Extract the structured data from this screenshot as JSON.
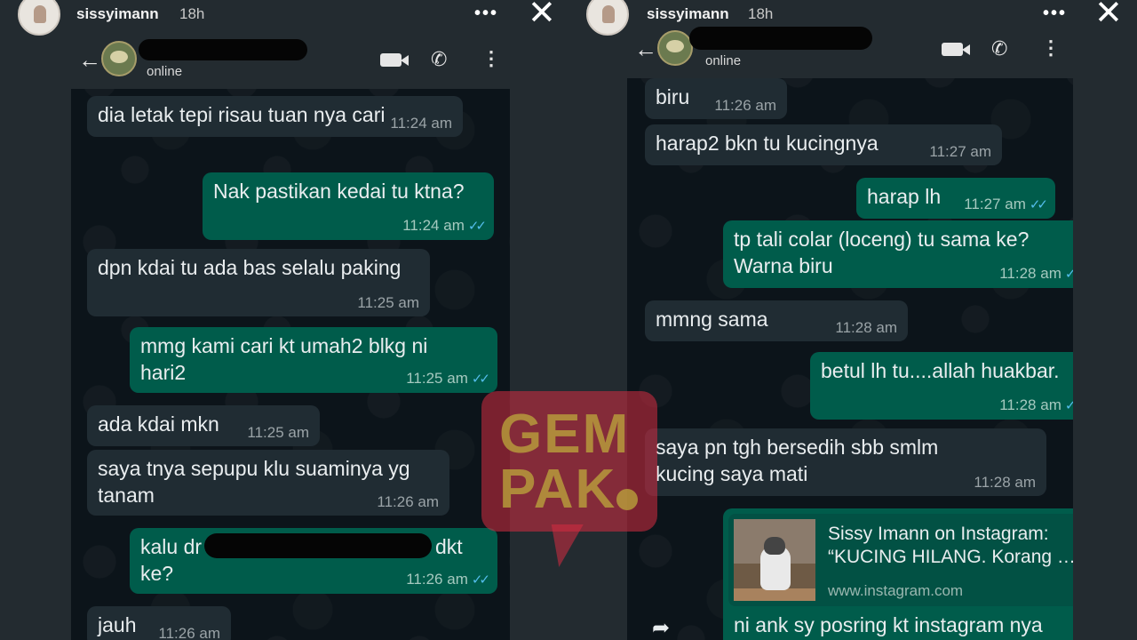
{
  "story": {
    "username": "sissyimann",
    "time_ago": "18h",
    "more_label": "•••",
    "close_label": "✕"
  },
  "chat": {
    "status": "online",
    "back_label": "←",
    "phone_label": "✆",
    "menu_label": "⋮"
  },
  "left_messages": [
    {
      "dir": "in",
      "text": "dia letak tepi risau tuan nya cari",
      "time": "11:24 am"
    },
    {
      "dir": "out",
      "text": "Nak pastikan kedai tu ktna?",
      "time": "11:24 am"
    },
    {
      "dir": "in",
      "text": "dpn kdai tu ada bas selalu paking",
      "time": "11:25 am"
    },
    {
      "dir": "out",
      "text": "mmg kami cari kt umah2 blkg ni hari2",
      "time": "11:25 am"
    },
    {
      "dir": "in",
      "text": "ada kdai mkn",
      "time": "11:25 am"
    },
    {
      "dir": "in",
      "text": "saya tnya sepupu klu suaminya yg tanam",
      "time": "11:26 am"
    },
    {
      "dir": "out",
      "text_a": "kalu dr",
      "text_b": "dkt",
      "text_c": "ke?",
      "time": "11:26 am"
    },
    {
      "dir": "in",
      "text": "jauh",
      "time": "11:26 am"
    }
  ],
  "right_messages": [
    {
      "dir": "in",
      "text": "biru",
      "time": "11:26 am"
    },
    {
      "dir": "in",
      "text": "harap2 bkn tu kucingnya",
      "time": "11:27 am"
    },
    {
      "dir": "out",
      "text": "harap lh",
      "time": "11:27 am"
    },
    {
      "dir": "out",
      "text": "tp tali colar (loceng) tu sama ke? Warna biru",
      "time": "11:28 am"
    },
    {
      "dir": "in",
      "text": "mmng sama",
      "time": "11:28 am"
    },
    {
      "dir": "out",
      "text": "betul lh tu....allah huakbar.",
      "time": "11:28 am"
    },
    {
      "dir": "in",
      "text": "saya pn tgh bersedih sbb smlm kucing saya mati",
      "time": "11:28 am"
    },
    {
      "dir": "out",
      "link_title_1": "Sissy Imann on Instagram:",
      "link_title_2": "“KUCING HILANG. Korang …",
      "link_url": "www.instagram.com",
      "text": "ni ank sy posring kt instagram nya"
    }
  ],
  "ticks": "✓✓",
  "share_label": "➦",
  "watermark": {
    "line1": "GEM",
    "line2": "PAK"
  }
}
